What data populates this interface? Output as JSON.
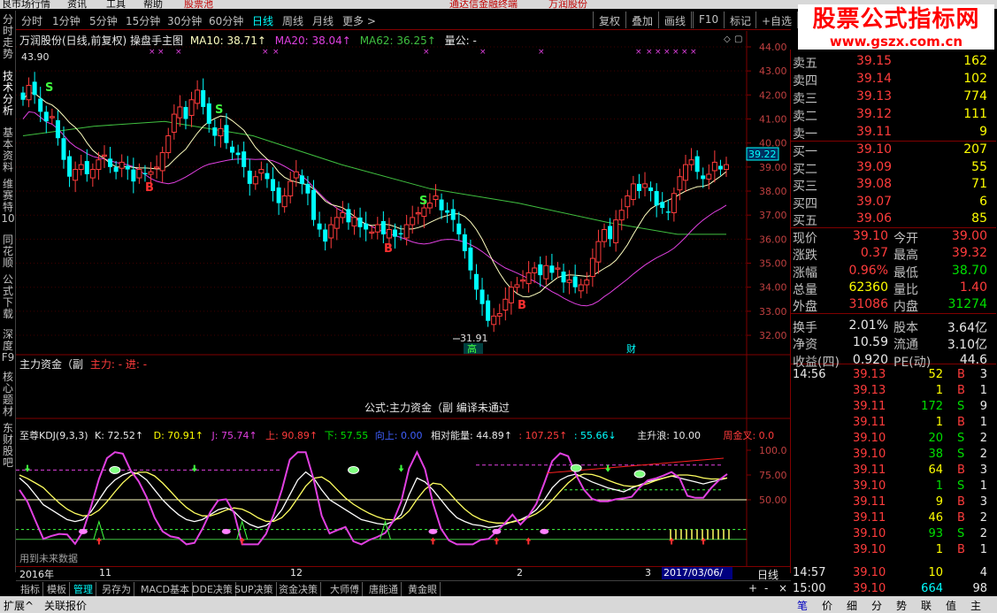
{
  "top_menu": [
    "艮市场行情",
    "资讯",
    "工具",
    "帮助",
    "股票池",
    "通达信金融终端",
    "万润股份"
  ],
  "period_tabs": [
    "分时",
    "1分钟",
    "5分钟",
    "15分钟",
    "30分钟",
    "60分钟",
    "日线",
    "周线",
    "月线",
    "更多 >"
  ],
  "active_period": "日线",
  "right_buttons": [
    "复权",
    "叠加",
    "画线",
    "F10",
    "标记",
    "+自选"
  ],
  "left_tabs": [
    "分时走势",
    "技术分析",
    "基本资料",
    "维赛特10",
    "同花顺",
    "公式下载",
    "深度F9",
    "核心题材",
    "东财股吧"
  ],
  "main_chart": {
    "title": "万润股份(日线,前复权) 操盘手主图",
    "ma10": "MA10: 38.71↑",
    "ma20": "MA20: 38.04↑",
    "ma62": "MA62: 36.25↑",
    "extra": "量公: -",
    "high_label": "43.90",
    "low_label": "31.91",
    "cur_price": "39.22",
    "price_ticks": [
      "44.00",
      "43.00",
      "42.00",
      "41.00",
      "40.00",
      "39.00",
      "38.00",
      "37.00",
      "36.00",
      "35.00",
      "34.00",
      "33.00",
      "32.00"
    ],
    "marker_gao": "高",
    "marker_cai": "财",
    "s_marks": [
      "S",
      "S",
      "S"
    ],
    "b_marks": [
      "B",
      "B",
      "B"
    ]
  },
  "main_force": {
    "title": "主力资金（副",
    "sub": "主力: - 进: -",
    "msg": "公式:主力资金（副 编译未通过"
  },
  "kdj": {
    "title": "至尊KDJ(9,3,3)",
    "k": "K: 72.52↑",
    "d": "D: 70.91↑",
    "j": "J: 75.74↑",
    "up": "上: 90.89↑",
    "down": "下: 57.55",
    "up2": "向上: 0.00",
    "rel": "相对能量: 44.89↑",
    "v1": ": 107.25↑",
    "v2": ": 55.66↓",
    "main_rise": "主升浪: 10.00",
    "gold": "周金叉: 0.0",
    "ticks": [
      "100.0",
      "75.00",
      "50.00"
    ],
    "future_note": "用到未来数据"
  },
  "date_bar": {
    "labels": [
      "2016年",
      "11",
      "12",
      "2",
      "3"
    ],
    "cursor_date": "2017/03/06/—",
    "right": "日线"
  },
  "bottom_tabs": [
    "指标",
    "模板",
    "管理",
    "另存为",
    "MACD基本",
    "DDE决策",
    "SUP决策",
    "资金决策",
    "大师傅",
    "唐能通",
    "黄金眼"
  ],
  "active_bottom_tab": "管理",
  "status_bar": [
    "扩展^",
    "关联报价"
  ],
  "watermark": {
    "title": "股票公式指标网",
    "url": "www.gszx.com.cn"
  },
  "orderbook": {
    "asks": [
      {
        "label": "卖五",
        "price": "39.15",
        "vol": "162"
      },
      {
        "label": "卖四",
        "price": "39.14",
        "vol": "102"
      },
      {
        "label": "卖三",
        "price": "39.13",
        "vol": "774"
      },
      {
        "label": "卖二",
        "price": "39.12",
        "vol": "111"
      },
      {
        "label": "卖一",
        "price": "39.11",
        "vol": "9"
      }
    ],
    "bids": [
      {
        "label": "买一",
        "price": "39.10",
        "vol": "207"
      },
      {
        "label": "买二",
        "price": "39.09",
        "vol": "55"
      },
      {
        "label": "买三",
        "price": "39.08",
        "vol": "71"
      },
      {
        "label": "买四",
        "price": "39.07",
        "vol": "6"
      },
      {
        "label": "买五",
        "price": "39.06",
        "vol": "85"
      }
    ]
  },
  "stats": [
    {
      "l1": "现价",
      "v1": "39.10",
      "l2": "今开",
      "v2": "39.00",
      "c1": "red",
      "c2": "red"
    },
    {
      "l1": "涨跌",
      "v1": "0.37",
      "l2": "最高",
      "v2": "39.32",
      "c1": "red",
      "c2": "red"
    },
    {
      "l1": "涨幅",
      "v1": "0.96%",
      "l2": "最低",
      "v2": "38.70",
      "c1": "red",
      "c2": "grn"
    },
    {
      "l1": "总量",
      "v1": "62360",
      "l2": "量比",
      "v2": "1.40",
      "c1": "yel",
      "c2": "red"
    },
    {
      "l1": "外盘",
      "v1": "31086",
      "l2": "内盘",
      "v2": "31274",
      "c1": "red",
      "c2": "grn"
    },
    {
      "l1": "换手",
      "v1": "2.01%",
      "l2": "股本",
      "v2": "3.64亿",
      "c1": "wht",
      "c2": "wht"
    },
    {
      "l1": "净资",
      "v1": "10.59",
      "l2": "流通",
      "v2": "3.10亿",
      "c1": "wht",
      "c2": "wht"
    },
    {
      "l1": "收益(四)",
      "v1": "0.920",
      "l2": "PE(动)",
      "v2": "44.6",
      "c1": "wht",
      "c2": "wht"
    }
  ],
  "ticks": [
    {
      "time": "14:56",
      "price": "39.13",
      "vol": "52",
      "bs": "B",
      "n": "3"
    },
    {
      "time": "",
      "price": "39.13",
      "vol": "1",
      "bs": "B",
      "n": "1"
    },
    {
      "time": "",
      "price": "39.11",
      "vol": "172",
      "bs": "S",
      "n": "9"
    },
    {
      "time": "",
      "price": "39.11",
      "vol": "1",
      "bs": "B",
      "n": "1"
    },
    {
      "time": "",
      "price": "39.10",
      "vol": "20",
      "bs": "S",
      "n": "2"
    },
    {
      "time": "",
      "price": "39.10",
      "vol": "38",
      "bs": "S",
      "n": "2"
    },
    {
      "time": "",
      "price": "39.11",
      "vol": "64",
      "bs": "B",
      "n": "3"
    },
    {
      "time": "",
      "price": "39.10",
      "vol": "1",
      "bs": "S",
      "n": "1"
    },
    {
      "time": "",
      "price": "39.11",
      "vol": "9",
      "bs": "B",
      "n": "3"
    },
    {
      "time": "",
      "price": "39.11",
      "vol": "46",
      "bs": "B",
      "n": "2"
    },
    {
      "time": "",
      "price": "39.10",
      "vol": "93",
      "bs": "S",
      "n": "2"
    },
    {
      "time": "",
      "price": "39.10",
      "vol": "1",
      "bs": "B",
      "n": "1"
    },
    {
      "time": "14:57",
      "price": "39.10",
      "vol": "10",
      "bs": "",
      "n": "4"
    },
    {
      "time": "15:00",
      "price": "39.10",
      "vol": "664",
      "bs": "",
      "n": "98"
    }
  ],
  "right_bottom_tabs": [
    "笔",
    "价",
    "细",
    "分",
    "势",
    "联",
    "值",
    "主"
  ],
  "colors": {
    "up": "#ff3c3c",
    "down": "#00ffff",
    "ma10": "#ffffc0",
    "ma20": "#e040e0",
    "ma62": "#40c040",
    "k_line": "#ffffff",
    "d_line": "#ffff60",
    "j_line": "#e040e0"
  }
}
